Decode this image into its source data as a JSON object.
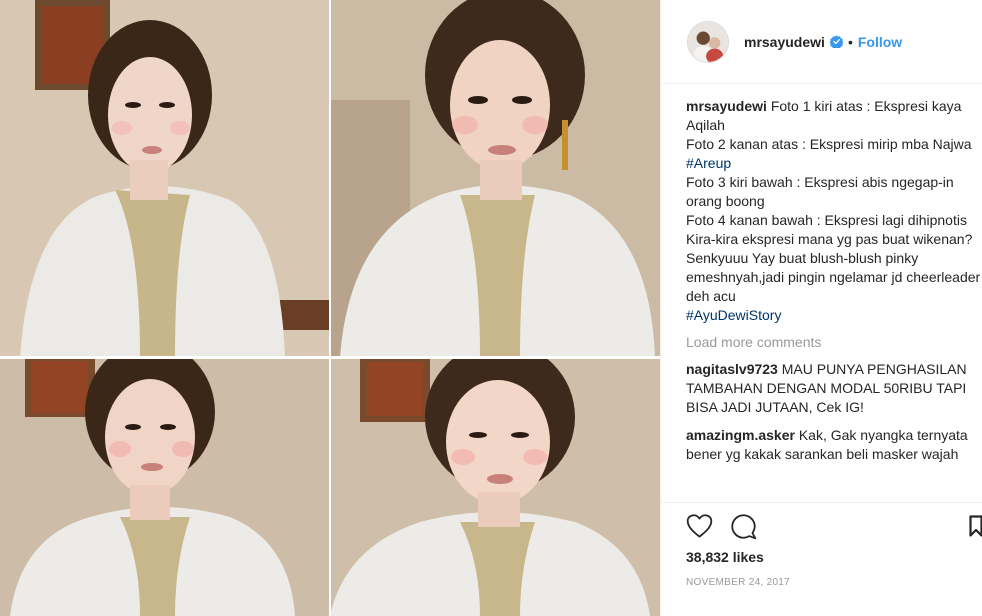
{
  "post": {
    "username": "mrsayudewi",
    "follow_label": "Follow",
    "separator": "•",
    "caption_user": "mrsayudewi",
    "caption_lines": [
      {
        "text": " Foto 1 kiri atas : Ekspresi kaya Aqilah"
      },
      {
        "text": "Foto 2 kanan atas : Ekspresi mirip mba Najwa ",
        "tag": "#Areup"
      },
      {
        "text": "Foto 3 kiri bawah : Ekspresi abis ngegap-in orang boong"
      },
      {
        "text": "Foto 4 kanan bawah : Ekspresi lagi dihipnotis"
      },
      {
        "text": "Kira-kira ekspresi mana yg pas buat wikenan?"
      },
      {
        "text": "Senkyuuu Yay buat blush-blush pinky emeshnyah,jadi pingin ngelamar jd cheerleader deh acu"
      },
      {
        "text": "",
        "tag": "#AyuDewiStory"
      }
    ],
    "load_more": "Load more comments",
    "comments": [
      {
        "user": "nagitaslv9723",
        "text": " MAU PUNYA PENGHASILAN TAMBAHAN DENGAN MODAL 50RIBU TAPI BISA JADI JUTAAN, Cek IG!"
      },
      {
        "user": "amazingm.asker",
        "text": " Kak, Gak nyangka ternyata bener yg kakak sarankan beli masker wajah"
      }
    ],
    "likes": "38,832 likes",
    "date": "NOVEMBER 24, 2017"
  },
  "colors": {
    "link": "#3897f0",
    "hashtag": "#003569",
    "muted": "#999999",
    "verified": "#3897f0"
  },
  "icons": [
    "verified-badge-icon",
    "heart-icon",
    "comment-icon",
    "bookmark-icon"
  ]
}
